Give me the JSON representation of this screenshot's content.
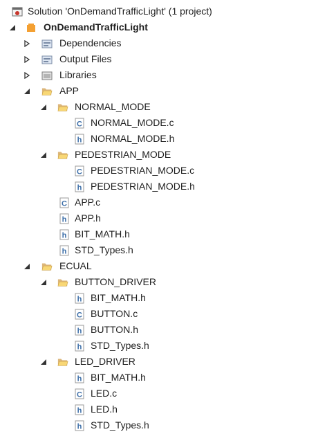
{
  "solution": {
    "label": "Solution 'OnDemandTrafficLight' (1 project)"
  },
  "project": {
    "label": "OnDemandTrafficLight"
  },
  "dependencies": {
    "label": "Dependencies"
  },
  "output_files": {
    "label": "Output Files"
  },
  "libraries": {
    "label": "Libraries"
  },
  "app": {
    "label": "APP",
    "normal_mode": {
      "label": "NORMAL_MODE",
      "files": [
        "NORMAL_MODE.c",
        "NORMAL_MODE.h"
      ]
    },
    "pedestrian_mode": {
      "label": "PEDESTRIAN_MODE",
      "files": [
        "PEDESTRIAN_MODE.c",
        "PEDESTRIAN_MODE.h"
      ]
    },
    "files": [
      "APP.c",
      "APP.h",
      "BIT_MATH.h",
      "STD_Types.h"
    ]
  },
  "ecual": {
    "label": "ECUAL",
    "button_driver": {
      "label": "BUTTON_DRIVER",
      "files": [
        "BIT_MATH.h",
        "BUTTON.c",
        "BUTTON.h",
        "STD_Types.h"
      ]
    },
    "led_driver": {
      "label": "LED_DRIVER",
      "files": [
        "BIT_MATH.h",
        "LED.c",
        "LED.h",
        "STD_Types.h"
      ]
    }
  },
  "icons": {
    "folder": "folder-open-icon",
    "c_file": "c-source-file-icon",
    "h_file": "header-file-icon",
    "expanded": "expanded-arrow-icon",
    "collapsed": "collapsed-arrow-icon"
  },
  "colors": {
    "folder": "#dcb67a",
    "project": "#f4a032",
    "file_letter": "#3c6ea8",
    "arrow": "#333333"
  }
}
